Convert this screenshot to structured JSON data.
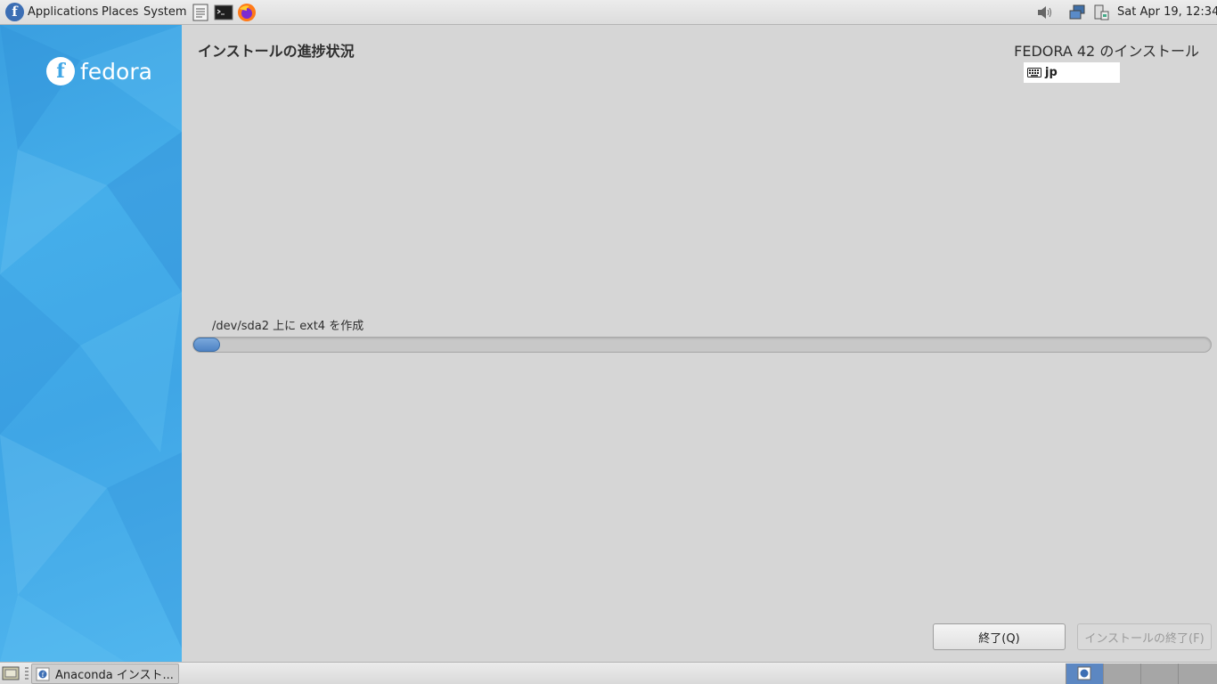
{
  "top_panel": {
    "menus": [
      "Applications",
      "Places",
      "System"
    ],
    "clock": "Sat Apr 19, 12:34"
  },
  "sidebar": {
    "logo_text": "fedora"
  },
  "main": {
    "page_title": "インストールの進捗状況",
    "product_title": "FEDORA 42 のインストール",
    "keyboard_layout": "jp",
    "progress_label": "/dev/sda2 上に ext4 を作成",
    "progress_value": 0.02,
    "quit_button": "終了(Q)",
    "finish_button": "インストールの終了(F)"
  },
  "bottom_panel": {
    "task_label": "Anaconda インスト...",
    "workspaces": 4,
    "active_workspace": 1
  },
  "colors": {
    "accent": "#4e83c4",
    "sidebar": "#3fa6e6"
  }
}
